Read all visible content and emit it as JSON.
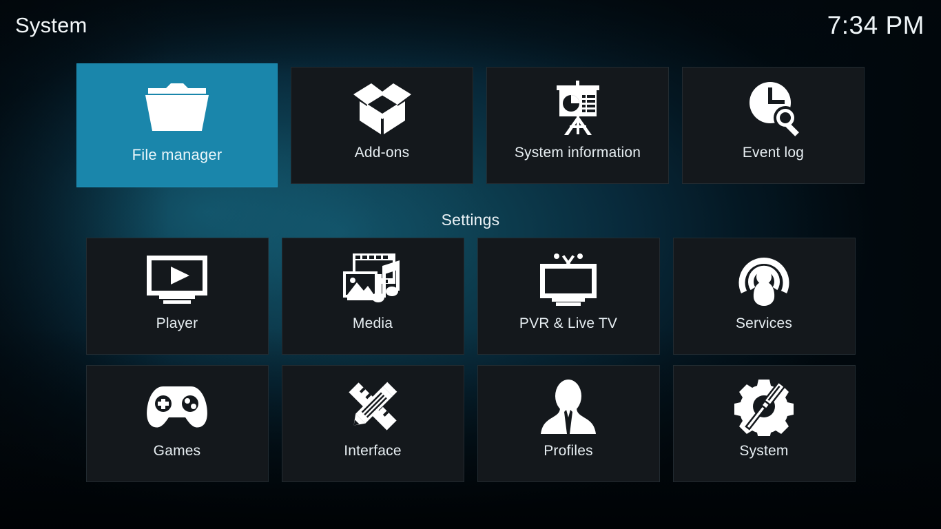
{
  "header": {
    "title": "System",
    "clock": "7:34 PM"
  },
  "colors": {
    "focus_accent": "#1a86ab",
    "tile_background": "#14181c",
    "text_primary": "#e7eef2",
    "background_teal": "#125166"
  },
  "sections": {
    "top_row": {
      "tiles": [
        {
          "label": "File manager",
          "icon": "folder-icon",
          "focused": true
        },
        {
          "label": "Add-ons",
          "icon": "open-box-icon",
          "focused": false
        },
        {
          "label": "System information",
          "icon": "presentation-chart-icon",
          "focused": false
        },
        {
          "label": "Event log",
          "icon": "clock-magnifier-icon",
          "focused": false
        }
      ]
    },
    "settings": {
      "heading": "Settings",
      "rows": [
        {
          "tiles": [
            {
              "label": "Player",
              "icon": "monitor-play-icon"
            },
            {
              "label": "Media",
              "icon": "film-photo-music-icon"
            },
            {
              "label": "PVR & Live TV",
              "icon": "tv-antenna-icon"
            },
            {
              "label": "Services",
              "icon": "broadcast-person-icon"
            }
          ]
        },
        {
          "tiles": [
            {
              "label": "Games",
              "icon": "gamepad-icon"
            },
            {
              "label": "Interface",
              "icon": "pencil-ruler-icon"
            },
            {
              "label": "Profiles",
              "icon": "person-bust-icon"
            },
            {
              "label": "System",
              "icon": "gear-screwdriver-icon"
            }
          ]
        }
      ]
    }
  }
}
